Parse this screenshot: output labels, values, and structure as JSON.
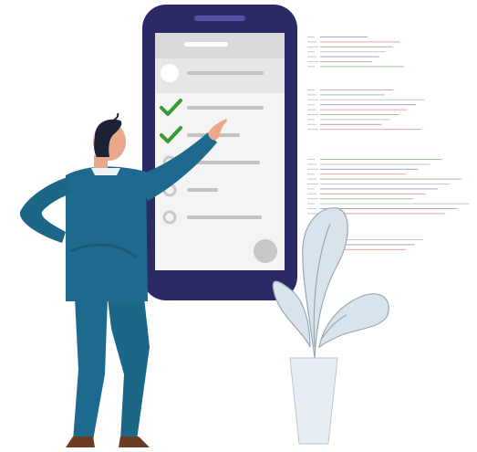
{
  "phone": {
    "frame_color": "#2c2a66",
    "screen_color": "#f4f4f4",
    "header_color": "#e2e2e2",
    "placeholder_color": "#c2c2c2",
    "check_color": "#3a9a35",
    "checklist": [
      {
        "state": "checked"
      },
      {
        "state": "checked"
      },
      {
        "state": "empty"
      },
      {
        "state": "empty"
      },
      {
        "state": "empty"
      }
    ],
    "fab_icon": "circle-button-icon"
  },
  "person": {
    "suit_color": "#1e6a8f",
    "hair_color": "#1b2235",
    "skin_color": "#e9a88a",
    "shoe_color": "#6b3b22"
  },
  "plant": {
    "leaf_color": "#d9e3ec",
    "vase_color": "#e6edf3",
    "stroke_color": "#9aa9b6"
  },
  "code_lines_panel": {
    "line_colors": [
      "#8b86b8",
      "#d98a8a",
      "#79b27a",
      "#b4b4b4"
    ]
  }
}
